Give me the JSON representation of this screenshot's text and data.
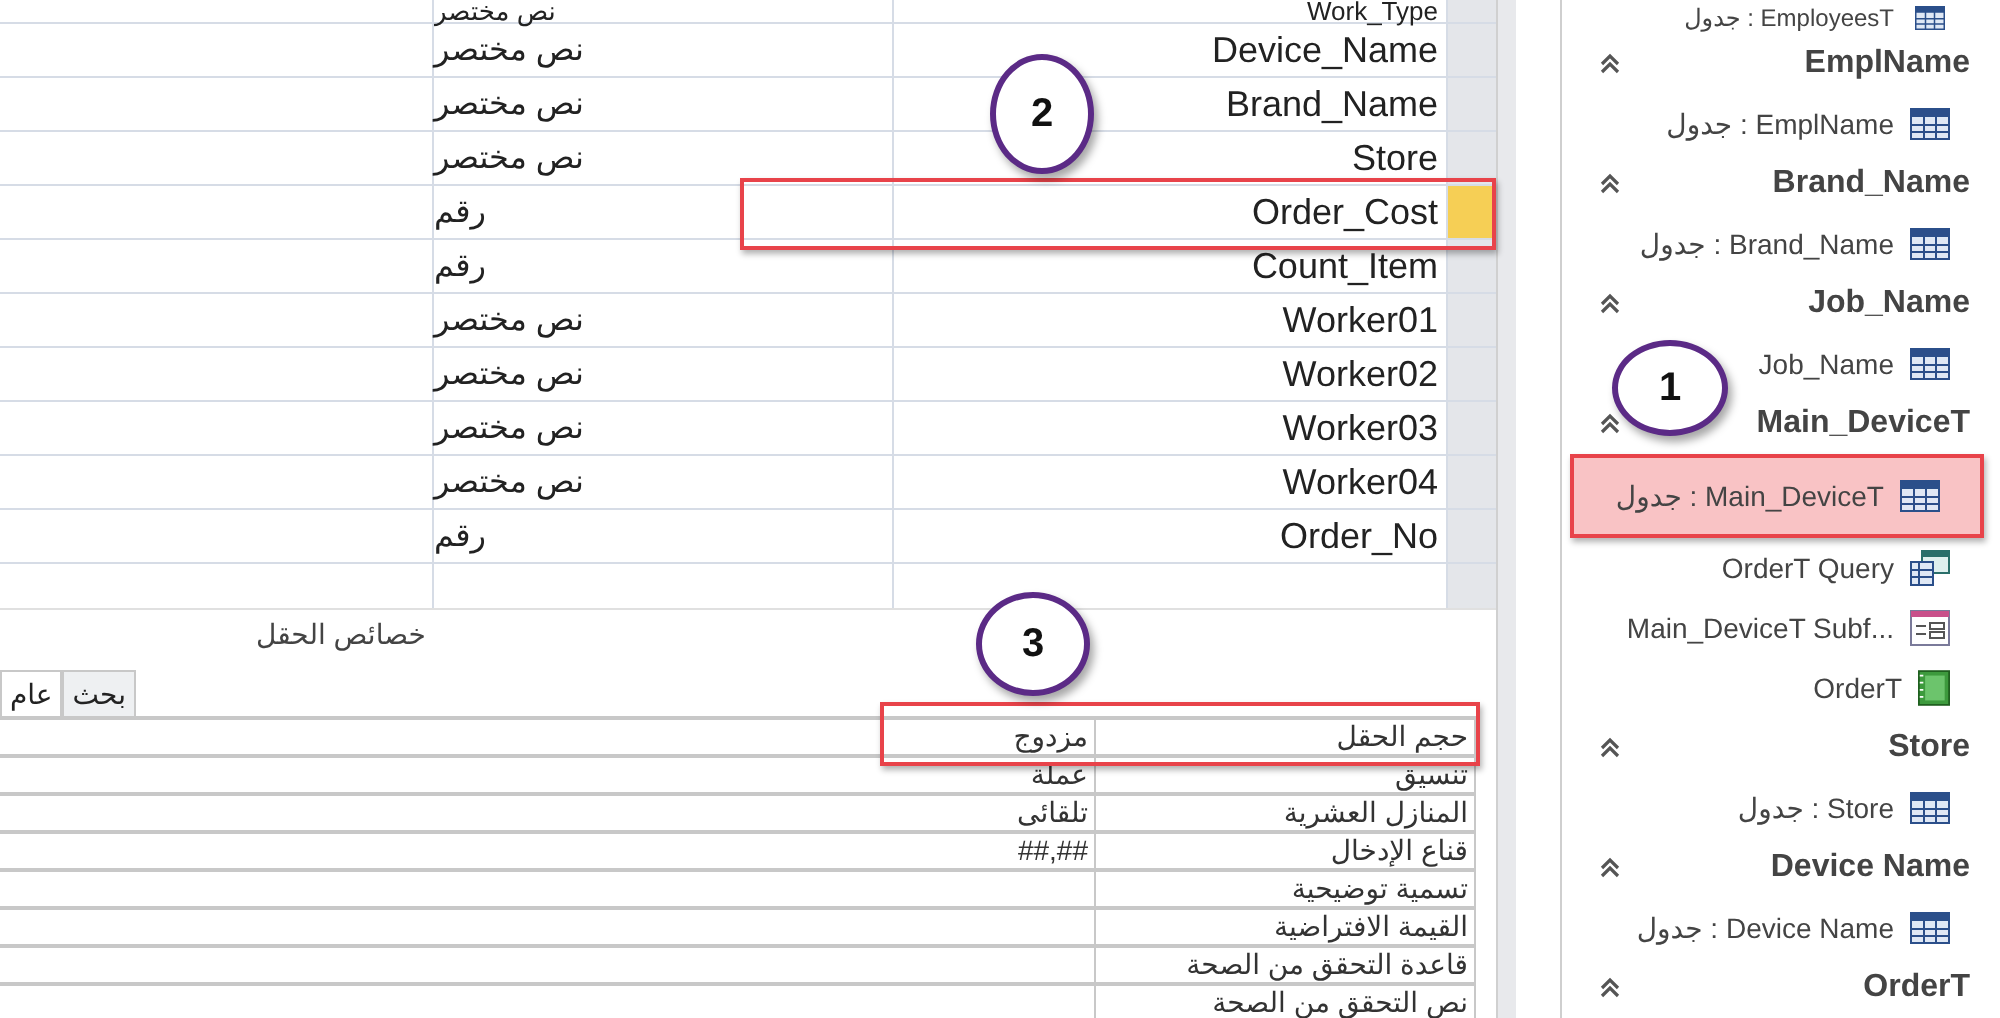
{
  "fields": [
    {
      "name": "Work_Type",
      "type": "نص مختصر",
      "selected": false
    },
    {
      "name": "Device_Name",
      "type": "نص مختصر",
      "selected": false
    },
    {
      "name": "Brand_Name",
      "type": "نص مختصر",
      "selected": false
    },
    {
      "name": "Store",
      "type": "نص مختصر",
      "selected": false
    },
    {
      "name": "Order_Cost",
      "type": "رقم",
      "selected": true
    },
    {
      "name": "Count_Item",
      "type": "رقم",
      "selected": false
    },
    {
      "name": "Worker01",
      "type": "نص مختصر",
      "selected": false
    },
    {
      "name": "Worker02",
      "type": "نص مختصر",
      "selected": false
    },
    {
      "name": "Worker03",
      "type": "نص مختصر",
      "selected": false
    },
    {
      "name": "Worker04",
      "type": "نص مختصر",
      "selected": false
    },
    {
      "name": "Order_No",
      "type": "رقم",
      "selected": false
    }
  ],
  "field_properties": {
    "title": "خصائص الحقل",
    "tabs": [
      {
        "label": "بحث",
        "selected": false
      },
      {
        "label": "عام",
        "selected": true
      }
    ],
    "rows": [
      {
        "label": "حجم الحقل",
        "value": "مزدوج"
      },
      {
        "label": "تنسيق",
        "value": "عملة"
      },
      {
        "label": "المنازل العشرية",
        "value": "تلقائى"
      },
      {
        "label": "قناع الإدخال",
        "value": "##,##"
      },
      {
        "label": "تسمية توضيحية"
      },
      {
        "label": "القيمة الافتراضية"
      },
      {
        "label": "قاعدة التحقق من الصحة"
      },
      {
        "label": "نص التحقق من الصحة"
      }
    ]
  },
  "navigation_pane": {
    "groups": [
      {
        "items": [
          {
            "kind": "table",
            "label": "جدول : EmployeesT",
            "selected": false
          }
        ]
      },
      {
        "title": "EmplName",
        "items": [
          {
            "kind": "table",
            "label": "جدول : EmplName",
            "selected": false
          }
        ]
      },
      {
        "title": "Brand_Name",
        "items": [
          {
            "kind": "table",
            "label": "جدول : Brand_Name",
            "selected": false
          }
        ]
      },
      {
        "title": "Job_Name",
        "items": [
          {
            "kind": "table",
            "label": "Job_Name",
            "selected": false
          }
        ]
      },
      {
        "title": "Main_DeviceT",
        "items": [
          {
            "kind": "table",
            "label": "جدول : Main_DeviceT",
            "selected": true
          },
          {
            "kind": "query",
            "label": "OrderT Query",
            "selected": false
          },
          {
            "kind": "form",
            "label": "Main_DeviceT Subf...",
            "selected": false
          },
          {
            "kind": "report",
            "label": "OrderT",
            "selected": false
          }
        ]
      },
      {
        "title": "Store",
        "items": [
          {
            "kind": "table",
            "label": "جدول : Store",
            "selected": false
          }
        ]
      },
      {
        "title": "Device Name",
        "items": [
          {
            "kind": "table",
            "label": "جدول : Device Name",
            "selected": false
          }
        ]
      },
      {
        "title": "OrderT"
      }
    ]
  },
  "annotations": [
    {
      "label": "1"
    },
    {
      "label": "2"
    },
    {
      "label": "3"
    }
  ]
}
